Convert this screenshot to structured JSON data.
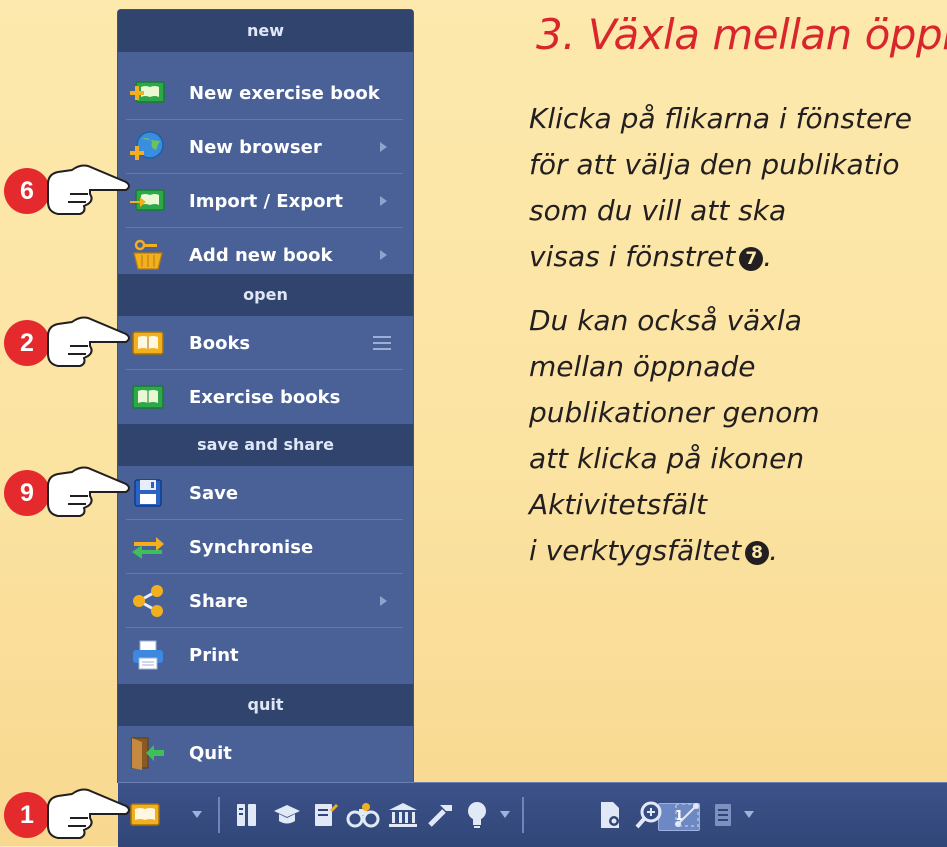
{
  "heading": "3. Växla mellan öppn",
  "paragraphs": {
    "p1": [
      "Klicka på flikarna i fönstere",
      "för att välja den publikatio",
      "som du vill att ska",
      "visas i fönstret"
    ],
    "p1_ref": "7",
    "p2": [
      "Du kan också växla",
      "mellan öppnade",
      "publikationer genom",
      "att klicka på ikonen",
      "Aktivitetsfält",
      "i verktygsfältet"
    ],
    "p2_ref": "8",
    "p1_end": ".",
    "p2_end": "."
  },
  "menu": {
    "sections": {
      "new": "new",
      "open": "open",
      "save_share": "save and share",
      "quit": "quit"
    },
    "items": [
      {
        "label": "New exercise book",
        "icon": "new-exercise-book-icon",
        "submenu": false
      },
      {
        "label": "New browser",
        "icon": "globe-plus-icon",
        "submenu": true
      },
      {
        "label": "Import / Export",
        "icon": "import-export-icon",
        "submenu": true
      },
      {
        "label": "Add new book",
        "icon": "basket-key-icon",
        "submenu": true
      },
      {
        "label": "Books",
        "icon": "book-icon",
        "submenu": false
      },
      {
        "label": "Exercise books",
        "icon": "exercise-book-icon",
        "submenu": false
      },
      {
        "label": "Save",
        "icon": "floppy-disk-icon",
        "submenu": false
      },
      {
        "label": "Synchronise",
        "icon": "sync-arrows-icon",
        "submenu": false
      },
      {
        "label": "Share",
        "icon": "share-icon",
        "submenu": true
      },
      {
        "label": "Print",
        "icon": "printer-icon",
        "submenu": false
      },
      {
        "label": "Quit",
        "icon": "exit-door-icon",
        "submenu": false
      }
    ]
  },
  "toolbar": {
    "page_number": "1",
    "icons": [
      "book-icon",
      "chevron-down-icon",
      "pages-icon",
      "graduation-cap-icon",
      "notes-icon",
      "binoculars-icon",
      "museum-icon",
      "tools-icon",
      "lightbulb-icon",
      "chevron-down-icon",
      "page-number-field",
      "page-settings-icon",
      "zoom-in-icon",
      "crop-icon",
      "list-icon"
    ]
  },
  "callouts": [
    "6",
    "2",
    "9",
    "1"
  ],
  "colors": {
    "menu_bg": "#4a6197",
    "section_bg": "#30446e",
    "heading_red": "#d9262c",
    "callout_red": "#e52a2e",
    "background_yellow": "#fde9ad"
  }
}
